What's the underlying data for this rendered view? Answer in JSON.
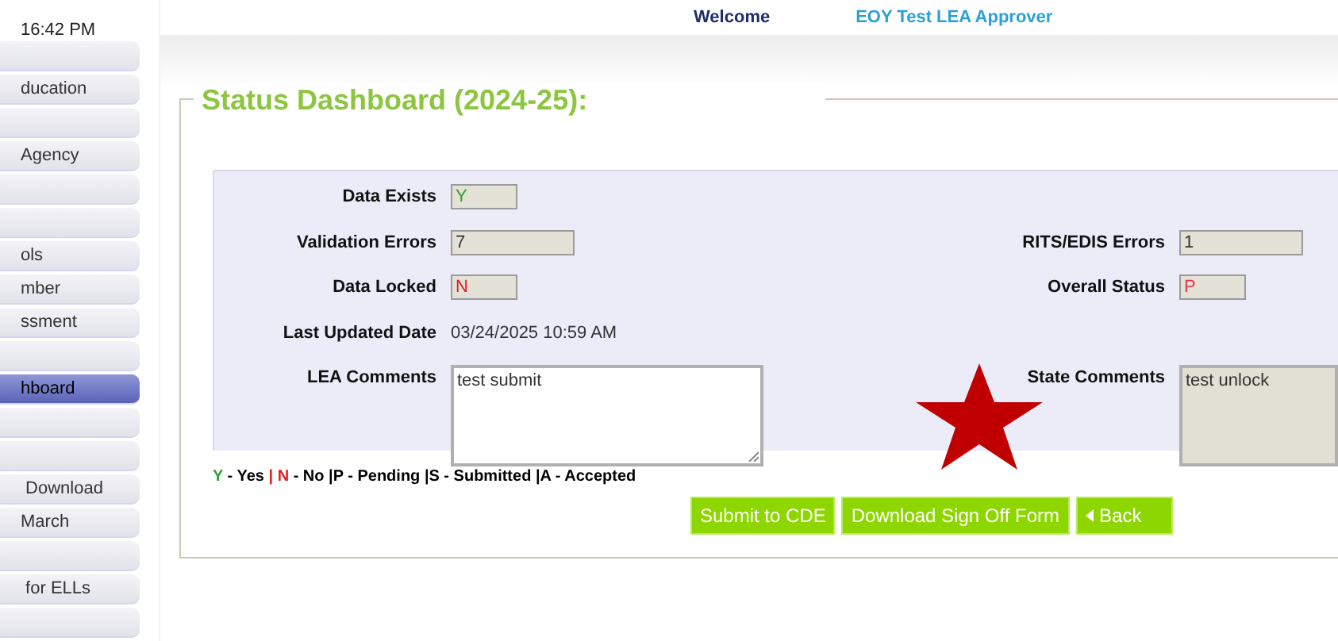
{
  "clock": "16:42 PM",
  "header": {
    "welcome": "Welcome",
    "user": "EOY Test LEA Approver"
  },
  "sidebar": {
    "items": [
      {
        "selected": false
      },
      {
        "label": "ducation",
        "selected": false
      },
      {
        "selected": false
      },
      {
        "label": "Agency",
        "selected": false
      },
      {
        "selected": false
      },
      {
        "selected": false
      },
      {
        "label": "ols",
        "selected": false
      },
      {
        "label": "mber",
        "selected": false
      },
      {
        "label": "ssment",
        "selected": false
      },
      {
        "selected": false
      },
      {
        "label": "hboard",
        "selected": true
      },
      {
        "selected": false
      },
      {
        "selected": false
      },
      {
        "label": " Download",
        "selected": false
      },
      {
        "label": "March",
        "selected": false
      },
      {
        "selected": false
      },
      {
        "label": " for ELLs",
        "selected": false
      },
      {
        "selected": false
      }
    ]
  },
  "title": "Status Dashboard (2024-25):",
  "rows": [
    {
      "left": {
        "label": "Data Exists",
        "kind": "flag",
        "value": "Y",
        "color": "#2e9e2e"
      }
    },
    {
      "left": {
        "label": "Validation Errors",
        "kind": "count",
        "value": "7",
        "color": "#333333"
      },
      "right": {
        "label": "RITS/EDIS Errors",
        "kind": "count",
        "value": "1",
        "color": "#333333"
      }
    },
    {
      "left": {
        "label": "Data Locked",
        "kind": "flag",
        "value": "N",
        "color": "#e02020"
      },
      "right": {
        "label": "Overall Status",
        "kind": "flag",
        "value": "P",
        "color": "#e83050"
      }
    },
    {
      "left": {
        "label": "Last Updated Date",
        "kind": "text",
        "value": "03/24/2025 10:59 AM"
      }
    },
    {
      "left": {
        "label": "LEA Comments",
        "kind": "textarea",
        "value": "test submit",
        "disabled": false
      },
      "right": {
        "label": "State Comments",
        "kind": "textarea",
        "value": "test unlock",
        "disabled": true
      }
    }
  ],
  "legend": [
    {
      "text": "Y",
      "color": "#2e9e2e"
    },
    {
      "text": " - Yes ",
      "color": "#000000"
    },
    {
      "text": "| ",
      "color": "#e02020"
    },
    {
      "text": "N",
      "color": "#e02020"
    },
    {
      "text": " - No |P - Pending |S - Submitted |A - Accepted",
      "color": "#000000"
    }
  ],
  "buttons": [
    {
      "label": "Submit to CDE",
      "kind": "plain"
    },
    {
      "label": "Download Sign Off Form",
      "kind": "plain"
    },
    {
      "label": "Back",
      "kind": "back"
    }
  ]
}
